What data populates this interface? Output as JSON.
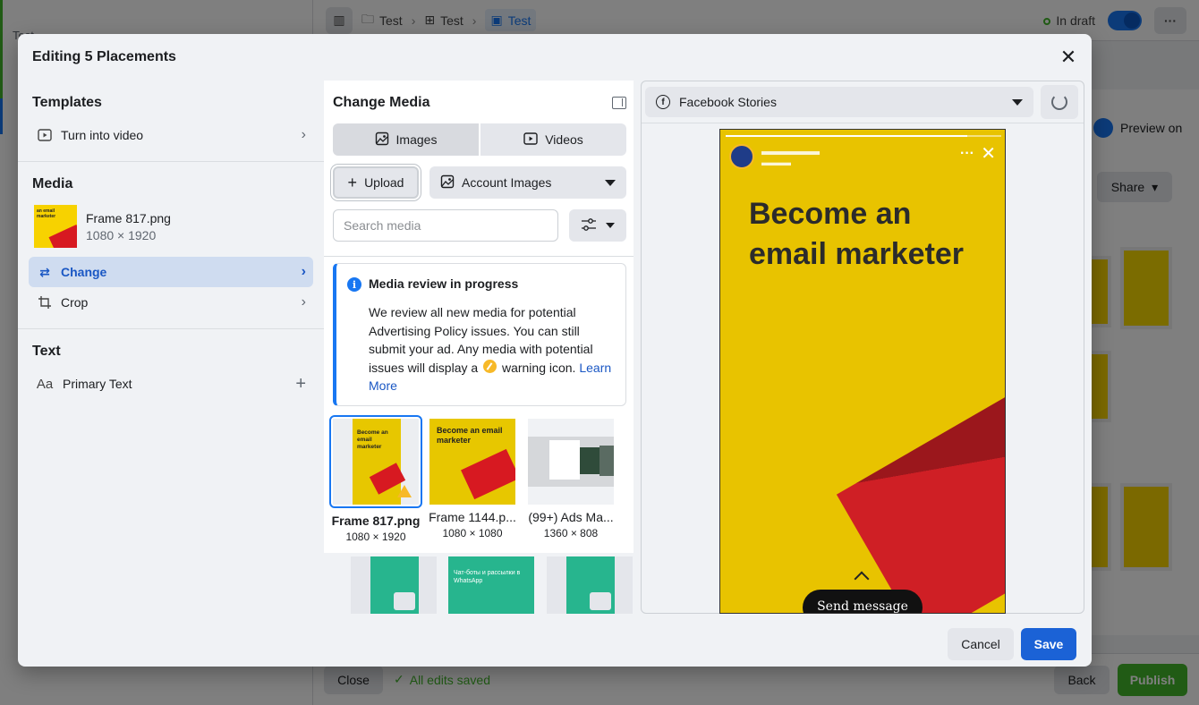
{
  "background": {
    "left_crumb": "Test",
    "breadcrumbs": [
      "Test",
      "Test",
      "Test"
    ],
    "status": "In draft",
    "preview_label": "Preview on",
    "share_label": "Share",
    "close_label": "Close",
    "saved_label": "All edits saved",
    "back_label": "Back",
    "publish_label": "Publish"
  },
  "modal": {
    "title": "Editing 5 Placements",
    "templates": {
      "title": "Templates",
      "items": [
        {
          "label": "Turn into video",
          "icon": "video-icon"
        }
      ]
    },
    "media": {
      "title": "Media",
      "file_name": "Frame 817.png",
      "file_dims": "1080 × 1920",
      "thumb_text": "an email marketer",
      "change_label": "Change",
      "crop_label": "Crop"
    },
    "text": {
      "title": "Text",
      "primary_label": "Primary Text"
    },
    "change_media": {
      "title": "Change Media",
      "tabs": [
        {
          "label": "Images",
          "active": true
        },
        {
          "label": "Videos",
          "active": false
        }
      ],
      "upload_label": "Upload",
      "account_images_label": "Account Images",
      "search_placeholder": "Search media",
      "notice": {
        "title": "Media review in progress",
        "body_before": "We review all new media for potential Advertising Policy issues. You can still submit your ad. Any media with potential issues will display a",
        "body_after": "warning icon.",
        "link": "Learn More"
      },
      "tiles": [
        {
          "name": "Frame 817.png",
          "dims": "1080 × 1920",
          "selected": true,
          "warning": true,
          "image_text": "Become an email marketer"
        },
        {
          "name": "Frame 1144.p...",
          "dims": "1080 × 1080",
          "selected": false,
          "image_text": "Become an email marketer"
        },
        {
          "name": "(99+) Ads Ma...",
          "dims": "1360 × 808",
          "selected": false
        }
      ],
      "row2_texts": [
        "",
        "Чат-боты и рассылки в WhatsApp",
        ""
      ]
    },
    "preview": {
      "placement": "Facebook Stories",
      "headline": "Become an email marketer",
      "cta": "Send message"
    },
    "cancel_label": "Cancel",
    "save_label": "Save"
  },
  "colors": {
    "accent": "#1877f2",
    "save": "#1b62d6",
    "publish": "#42b72a",
    "brand_yellow": "#e8c300",
    "envelope_red": "#cf1f25"
  }
}
